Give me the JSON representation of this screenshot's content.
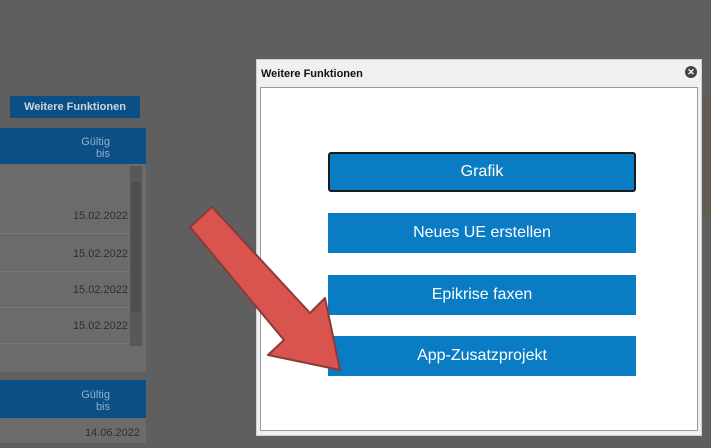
{
  "background": {
    "more_functions_button": "Weitere Funktionen",
    "table1_header": [
      "Gültig",
      "bis"
    ],
    "table1_rows": [
      "15.02.2022",
      "15.02.2022",
      "15.02.2022",
      "15.02.2022"
    ],
    "table2_header": [
      "Gültig",
      "bis"
    ],
    "table2_rows": [
      "14.06.2022"
    ]
  },
  "modal": {
    "title": "Weitere Funktionen",
    "close_icon": "close-icon",
    "buttons": [
      {
        "label": "Grafik",
        "focused": true
      },
      {
        "label": "Neues UE erstellen",
        "focused": false
      },
      {
        "label": "Epikrise faxen",
        "focused": false
      },
      {
        "label": "App-Zusatzprojekt",
        "focused": false
      }
    ]
  },
  "annotation": {
    "arrow_color": "#d9534f",
    "points_to": "App-Zusatzprojekt"
  },
  "colors": {
    "accent": "#0a7cc4",
    "overlay": "#5f5f5f"
  }
}
